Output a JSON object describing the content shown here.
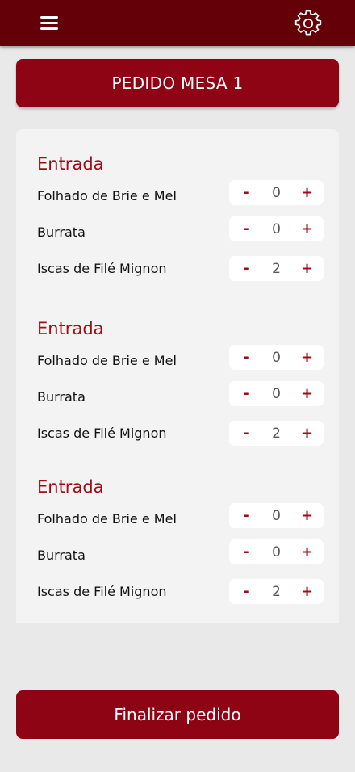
{
  "header": {
    "menu_icon": "hamburger-menu-icon",
    "settings_icon": "gear-icon",
    "background_color": "#640008"
  },
  "title": "PEDIDO MESA 1",
  "accent_color": "#8e0414",
  "sections": [
    {
      "title": "Entrada",
      "items": [
        {
          "name": "Folhado de Brie e Mel",
          "qty": "0"
        },
        {
          "name": "Burrata",
          "qty": "0"
        },
        {
          "name": "Iscas de Filé Mignon",
          "qty": "2"
        }
      ]
    },
    {
      "title": "Entrada",
      "items": [
        {
          "name": "Folhado de Brie e Mel",
          "qty": "0"
        },
        {
          "name": "Burrata",
          "qty": "0"
        },
        {
          "name": "Iscas de Filé Mignon",
          "qty": "2"
        }
      ]
    },
    {
      "title": "Entrada",
      "items": [
        {
          "name": "Folhado de Brie e Mel",
          "qty": "0"
        },
        {
          "name": "Burrata",
          "qty": "0"
        },
        {
          "name": "Iscas de Filé Mignon",
          "qty": "2"
        }
      ]
    }
  ],
  "stepper": {
    "minus": "-",
    "plus": "+"
  },
  "finish_button": "Finalizar pedido"
}
